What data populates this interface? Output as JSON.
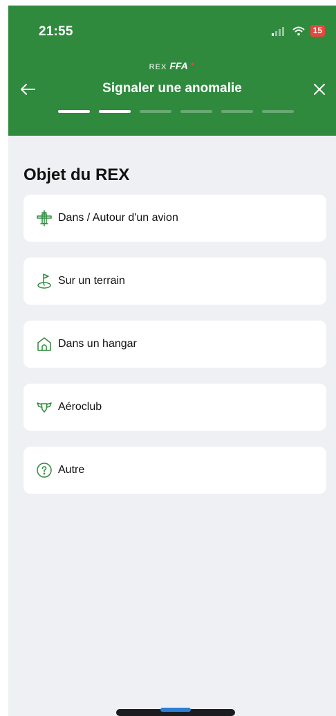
{
  "status_bar": {
    "time": "21:55",
    "battery": "15"
  },
  "header": {
    "brand_prefix": "REX",
    "brand_logo": "FFA",
    "title": "Signaler une anomalie",
    "total_steps": 6,
    "current_step": 2
  },
  "section": {
    "title": "Objet du REX"
  },
  "options": [
    {
      "label": "Dans / Autour d'un avion",
      "icon": "airplane-icon"
    },
    {
      "label": "Sur un terrain",
      "icon": "flag-terrain-icon"
    },
    {
      "label": "Dans un hangar",
      "icon": "hangar-icon"
    },
    {
      "label": "Aéroclub",
      "icon": "aeroclub-wings-icon"
    },
    {
      "label": "Autre",
      "icon": "question-icon"
    }
  ],
  "colors": {
    "header": "#2f8a3e",
    "background": "#eff0f4",
    "icon": "#2f8a3e"
  }
}
